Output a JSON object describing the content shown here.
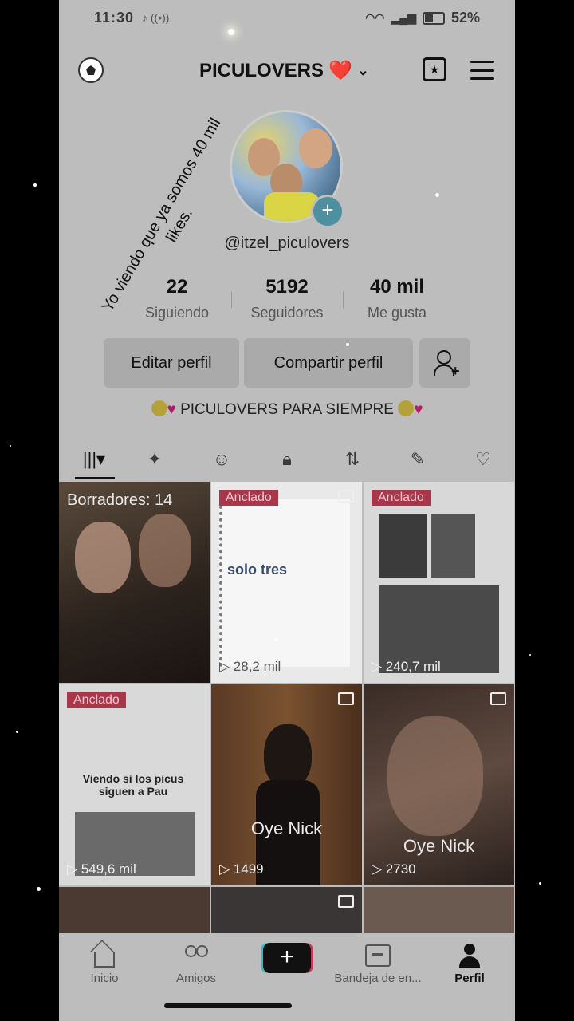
{
  "status_bar": {
    "time": "11:30",
    "battery": "52%"
  },
  "header": {
    "account_name": "PICULOVERS",
    "account_emoji": "❤️"
  },
  "overlay_caption": "Yo viendo que ya somos 40 mil likes.",
  "profile": {
    "handle": "@itzel_piculovers"
  },
  "stats": [
    {
      "value": "22",
      "label": "Siguiendo"
    },
    {
      "value": "5192",
      "label": "Seguidores"
    },
    {
      "value": "40 mil",
      "label": "Me gusta"
    }
  ],
  "actions": {
    "edit": "Editar perfil",
    "share": "Compartir perfil"
  },
  "bio": {
    "text": "PICULOVERS PARA SIEMPRE"
  },
  "tabs": [
    "videos",
    "favorites-sparkle",
    "stickers",
    "private",
    "reposts",
    "tagged",
    "liked"
  ],
  "grid": {
    "drafts": "Borradores: 14",
    "pinned_label": "Anclado",
    "items": [
      {
        "views": "28,2 mil",
        "text": "solo tres"
      },
      {
        "views": "240,7 mil"
      },
      {
        "views": "549,6 mil",
        "text": "Viendo si los picus siguen a Pau"
      },
      {
        "views": "1499",
        "caption": "Oye Nick"
      },
      {
        "views": "2730",
        "caption": "Oye Nick"
      }
    ]
  },
  "bottom_nav": {
    "home": "Inicio",
    "friends": "Amigos",
    "inbox": "Bandeja de en...",
    "profile": "Perfil"
  },
  "colors": {
    "background": "#bdbdbd",
    "pinned_badge": "#a7384a",
    "accent_teal": "#3cb7c2",
    "accent_red": "#c23a5a"
  }
}
